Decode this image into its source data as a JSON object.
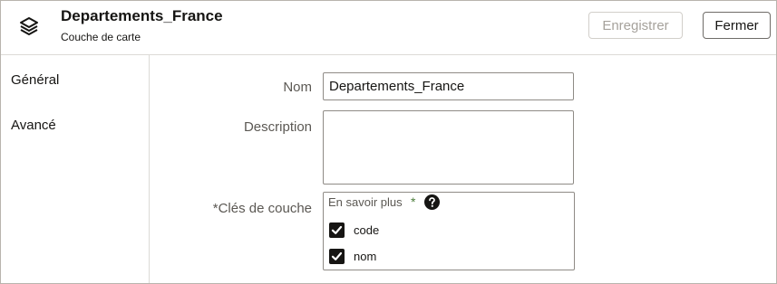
{
  "header": {
    "title": "Departements_France",
    "subtitle": "Couche de carte",
    "icon": "layers-icon",
    "save_label": "Enregistrer",
    "close_label": "Fermer"
  },
  "sidebar": {
    "items": [
      {
        "label": "Général"
      },
      {
        "label": "Avancé"
      }
    ]
  },
  "form": {
    "name_label": "Nom",
    "name_value": "Departements_France",
    "description_label": "Description",
    "description_value": "",
    "keys_label": "*Clés de couche",
    "learn_more": "En savoir plus",
    "required_marker": "*",
    "help_icon": "help-icon",
    "keys": [
      {
        "label": "code",
        "checked": true
      },
      {
        "label": "nom",
        "checked": true
      }
    ]
  },
  "colors": {
    "required_star": "#4b7d3b",
    "checkbox_fill": "#161513",
    "disabled_text": "#a6a29c"
  }
}
